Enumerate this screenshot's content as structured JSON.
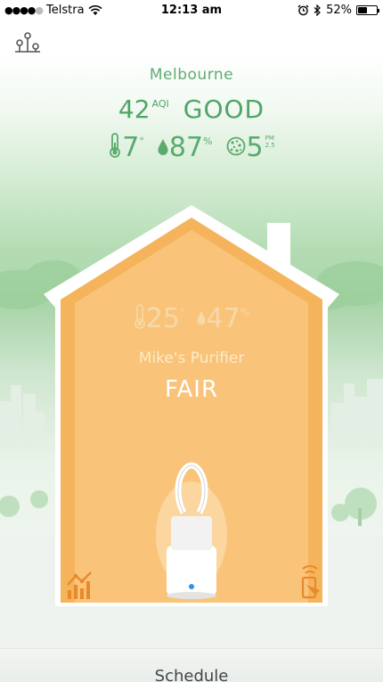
{
  "status_bar": {
    "carrier": "Telstra",
    "time": "12:13 am",
    "battery": "52%",
    "battery_level": 0.52
  },
  "outdoor": {
    "city": "Melbourne",
    "aqi_value": "42",
    "aqi_unit": "AQI",
    "aqi_status": "GOOD",
    "temperature": "7",
    "temperature_unit": "°",
    "humidity": "87",
    "humidity_unit": "%",
    "pm_value": "5",
    "pm_unit_top": "PM",
    "pm_unit_bottom": "2.5"
  },
  "indoor": {
    "temperature": "25",
    "temperature_unit": "°",
    "humidity": "47",
    "humidity_unit": "%",
    "device_name": "Mike's Purifier",
    "status": "FAIR"
  },
  "bottom": {
    "schedule_label": "Schedule"
  },
  "icons": {
    "logo": "app-logo-icon",
    "temperature": "thermometer-icon",
    "humidity": "droplet-icon",
    "pm": "particles-icon",
    "moon": "moon-icon",
    "history": "chart-icon",
    "remote": "remote-control-icon"
  },
  "colors": {
    "outdoor_green": "#4fa566",
    "house_orange": "#f5b45c",
    "accent_orange": "#e9892a",
    "device_blue_light": "#3a8fe0"
  }
}
